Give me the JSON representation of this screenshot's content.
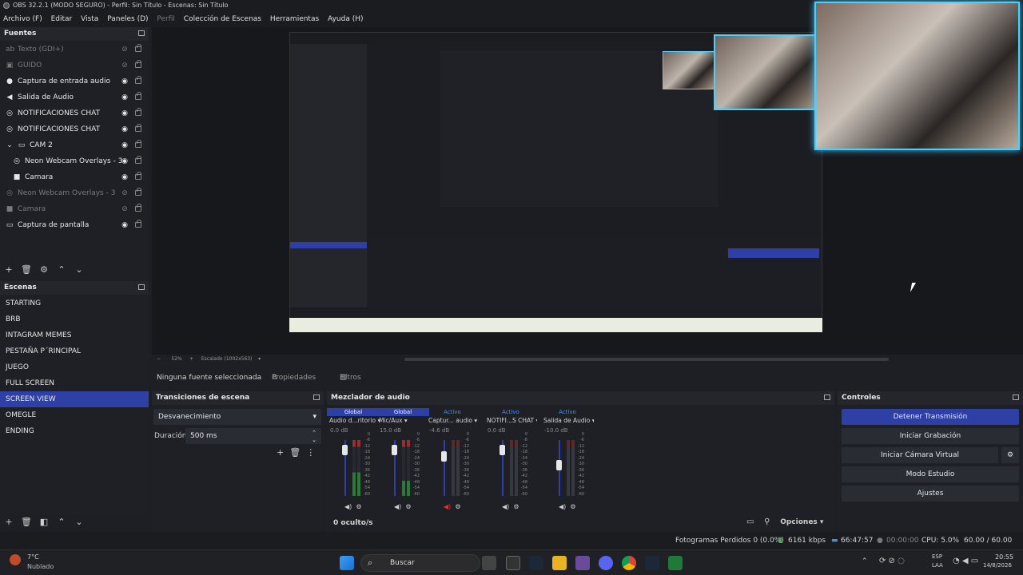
{
  "window": {
    "title": "OBS 32.2.1 (MODO SEGURO) - Perfil: Sin Título - Escenas: Sin Título"
  },
  "menu": [
    "Archivo (F)",
    "Editar",
    "Vista",
    "Paneles (D)",
    "Perfil",
    "Colección de Escenas",
    "Herramientas",
    "Ayuda (H)"
  ],
  "sources": {
    "title": "Fuentes",
    "items": [
      {
        "label": "Texto (GDI+)",
        "icon": "text-icon",
        "dim": true
      },
      {
        "label": "GUIDO",
        "icon": "image-icon",
        "dim": true
      },
      {
        "label": "Captura de entrada audio",
        "icon": "mic-icon",
        "dim": false
      },
      {
        "label": "Salida de Audio",
        "icon": "speaker-icon",
        "dim": false
      },
      {
        "label": "NOTIFICACIONES CHAT",
        "icon": "browser-icon",
        "dim": false
      },
      {
        "label": "NOTIFICACIONES CHAT",
        "icon": "browser-icon",
        "dim": false
      },
      {
        "label": "CAM 2",
        "icon": "folder-icon",
        "dim": false
      },
      {
        "label": "Neon Webcam Overlays - 3",
        "icon": "browser-icon",
        "dim": false
      },
      {
        "label": "Camara",
        "icon": "camera-icon",
        "dim": false
      },
      {
        "label": "Neon Webcam Overlays - 3",
        "icon": "browser-icon",
        "dim": true
      },
      {
        "label": "Camara",
        "icon": "camera-icon",
        "dim": true
      },
      {
        "label": "Captura de pantalla",
        "icon": "monitor-icon",
        "dim": false
      }
    ]
  },
  "scenes": {
    "title": "Escenas",
    "items": [
      "STARTING",
      "BRB",
      "INTAGRAM MEMES",
      "PESTAÑA P´RINCIPAL",
      "JUEGO",
      "FULL SCREEN",
      "SCREEN VIEW",
      "OMEGLE",
      "ENDING"
    ],
    "selected": "SCREEN VIEW"
  },
  "preview": {
    "zoom": "52%",
    "scale_label": "Escalado (1002x563)"
  },
  "context": {
    "no_source": "Ninguna fuente seleccionada",
    "properties": "Propiedades",
    "filters": "Filtros"
  },
  "transitions": {
    "title": "Transiciones de escena",
    "selected": "Desvanecimiento",
    "duration_label": "Duración",
    "duration_value": "500 ms"
  },
  "mixer": {
    "title": "Mezclador de audio",
    "hidden": "0 oculto/s",
    "channels": [
      {
        "badge": "Global",
        "name": "Audio d...ritorio",
        "db": "0.0 dB",
        "level": 0.7,
        "fader": 0.82,
        "muted": false
      },
      {
        "badge": "Global",
        "name": "Mic/Aux",
        "db": "15.0 dB",
        "level": 0.45,
        "fader": 0.82,
        "muted": false
      },
      {
        "badge": "Activo",
        "name": "Captur... audio",
        "db": "-4.6 dB",
        "level": 0.0,
        "fader": 0.7,
        "muted": true
      },
      {
        "badge": "Activo",
        "name": "NOTIFI...S CHAT",
        "db": "0.0 dB",
        "level": 0.0,
        "fader": 0.82,
        "muted": false
      },
      {
        "badge": "Activo",
        "name": "Salida de Audio",
        "db": "-10.0 dB",
        "level": 0.0,
        "fader": 0.55,
        "muted": false
      }
    ],
    "scale": [
      "0",
      "-6",
      "-12",
      "-18",
      "-24",
      "-30",
      "-36",
      "-42",
      "-48",
      "-54",
      "-60"
    ],
    "options": "Opciones"
  },
  "controls": {
    "title": "Controles",
    "buttons": [
      "Detener Transmisión",
      "Iniciar Grabación",
      "Iniciar Cámara Virtual",
      "Modo Estudio",
      "Ajustes"
    ]
  },
  "status": {
    "dropped": "Fotogramas Perdidos 0 (0.0%)",
    "bitrate": "6161 kbps",
    "stream_time": "66:47:57",
    "rec_time": "00:00:00",
    "cpu": "CPU: 5.0%",
    "fps": "60.00 / 60.00 FPS"
  },
  "taskbar": {
    "weather_temp": "7°C",
    "weather_desc": "Nublado",
    "search": "Buscar",
    "lang1": "ESP",
    "lang2": "LAA",
    "time": "20:55",
    "date": "14/8/2026"
  }
}
